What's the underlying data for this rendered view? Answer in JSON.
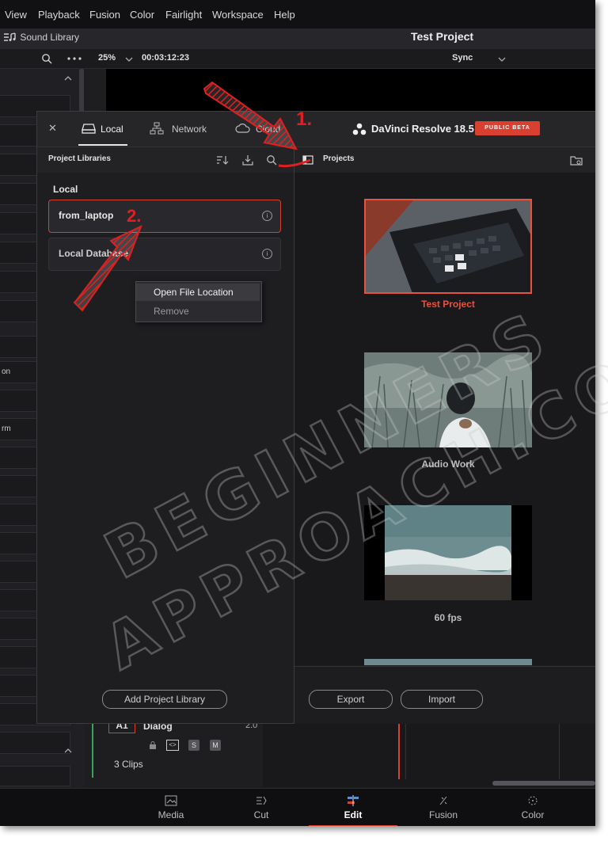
{
  "menubar": {
    "items": [
      "View",
      "Playback",
      "Fusion",
      "Color",
      "Fairlight",
      "Workspace",
      "Help"
    ]
  },
  "toolbar": {
    "sound_library": "Sound Library",
    "project_title": "Test Project"
  },
  "viewerbar": {
    "zoom": "25%",
    "timecode": "00:03:12:23",
    "sync": "Sync"
  },
  "leftstrip": {
    "label_on": "on",
    "label_rm": "rm"
  },
  "dialog": {
    "tabs": {
      "local": "Local",
      "network": "Network",
      "cloud": "Cloud"
    },
    "brand": "DaVinci Resolve 18.5",
    "beta": "PUBLIC BETA",
    "project_libraries": "Project Libraries",
    "projects_title": "Projects",
    "local_header": "Local",
    "libraries": [
      "from_laptop",
      "Local Database"
    ],
    "context_menu": {
      "open": "Open File Location",
      "remove": "Remove"
    },
    "add_library": "Add Project Library",
    "export": "Export",
    "import": "Import",
    "projects": [
      "Test Project",
      "Audio Work",
      "60 fps"
    ]
  },
  "track": {
    "name": "A1",
    "label": "Dialog",
    "value": "2.0",
    "solo": "S",
    "mute": "M",
    "clips": "3 Clips"
  },
  "pages": [
    "Media",
    "Cut",
    "Edit",
    "Fusion",
    "Color"
  ],
  "annotations": {
    "step1": "1.",
    "step2": "2."
  },
  "watermark": {
    "line1": "BEGINNERS",
    "line2": "APPROACH.COM"
  },
  "colors": {
    "accent_red": "#d9402f",
    "selected_project": "#e8533e"
  }
}
